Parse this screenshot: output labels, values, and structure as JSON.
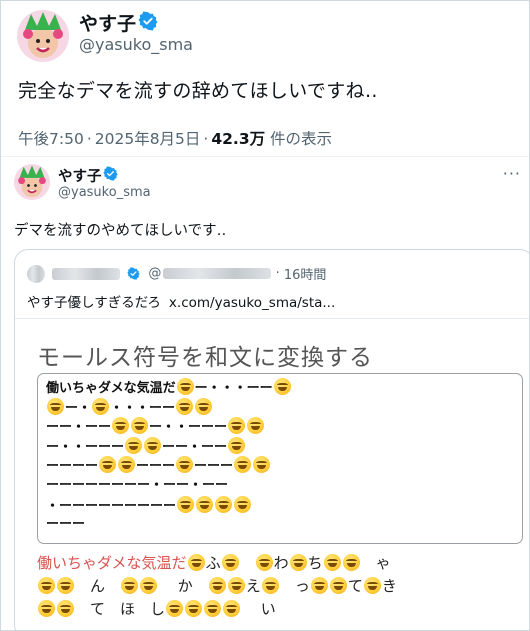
{
  "main_post": {
    "display_name": "やす子",
    "handle": "@yasuko_sma",
    "text": "完全なデマを流すの辞めてほしいですね‥",
    "time": "午後7:50",
    "date": "2025年8月5日",
    "views_count": "42.3万",
    "views_label": "件の表示"
  },
  "reply_post": {
    "display_name": "やす子",
    "handle": "@yasuko_sma",
    "more_label": "···",
    "text": "デマを流すのやめてほしいです‥"
  },
  "quoted_post": {
    "handle_prefix": "@",
    "time": "16時間",
    "text": "やす子優しすぎるだろ",
    "link": "x.com/yasuko_sma/sta..."
  },
  "converter": {
    "title": "モールス符号を和文に変換する",
    "input_lines": [
      "働いちゃダメな気温だ😆ー・・・ーー😆",
      "😆ー・😆・・・ーー😆😆",
      "ーー・ーー😆😆ー・・ーーー😆😆",
      "ー・・ーーー😆😆ーー・ーー😆",
      "ーーーー😆😆ーーー😆ーーー😆😆",
      "ーーーーーーーー・ーー・ーー",
      "・ーーーーーーーーー😆😆😆😆",
      "ーーー"
    ],
    "result_lines": [
      "働いちゃダメな気温だ😆ふ😆　😆わ😆ち😆😆　ゃ",
      "😆😆　ん　😆😆　 か　😆😆え😆　っ😆😆て😆き",
      "😆😆　て　ほ　し😆😆😆😆　 い"
    ]
  },
  "colors": {
    "verified_blue": "#1d9bf0",
    "result_highlight": "#d9534f"
  },
  "icons": {
    "verified": "verified-badge-icon",
    "emoji": "grinning-squinting-face-emoji"
  }
}
